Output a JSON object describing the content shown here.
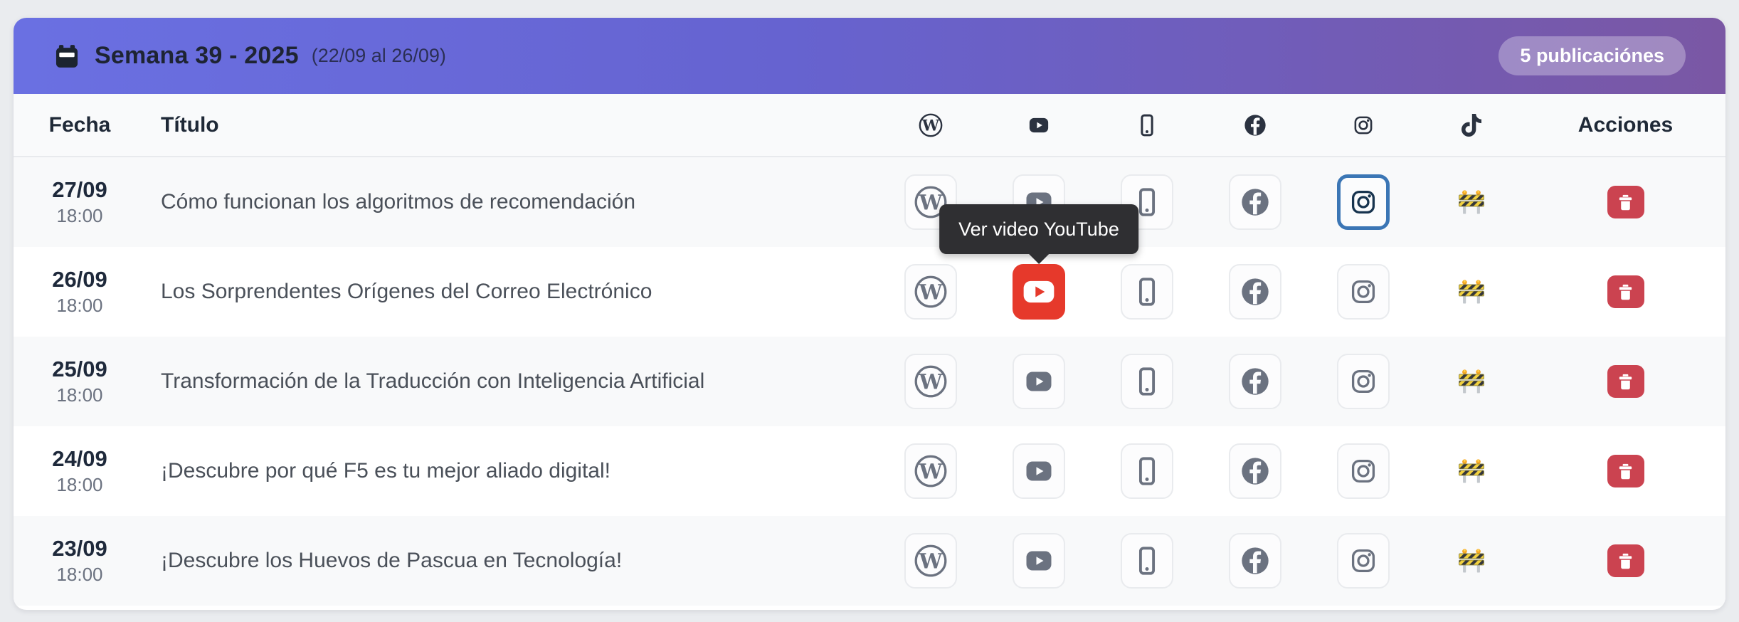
{
  "header": {
    "title": "Semana 39 - 2025",
    "range": "(22/09 al 26/09)",
    "badge": "5 publicaciónes"
  },
  "columns": {
    "fecha": "Fecha",
    "titulo": "Título",
    "acciones": "Acciones",
    "platforms": [
      "wordpress",
      "youtube",
      "mobile-app",
      "facebook",
      "instagram",
      "tiktok"
    ]
  },
  "tooltip": {
    "text": "Ver video YouTube"
  },
  "rows": [
    {
      "date": "27/09",
      "time": "18:00",
      "title": "Cómo funcionan los algoritmos de recomendación",
      "active_platform": "instagram"
    },
    {
      "date": "26/09",
      "time": "18:00",
      "title": "Los Sorprendentes Orígenes del Correo Electrónico",
      "active_platform": "youtube"
    },
    {
      "date": "25/09",
      "time": "18:00",
      "title": "Transformación de la Traducción con Inteligencia Artificial",
      "active_platform": null
    },
    {
      "date": "24/09",
      "time": "18:00",
      "title": "¡Descubre por qué F5 es tu mejor aliado digital!",
      "active_platform": null
    },
    {
      "date": "23/09",
      "time": "18:00",
      "title": "¡Descubre los Huevos de Pascua en Tecnología!",
      "active_platform": null
    }
  ],
  "colors": {
    "header_gradient_start": "#6a70e2",
    "header_gradient_end": "#7a57a4",
    "active_youtube_red": "#e6392b",
    "active_instagram_border": "#3b76b5",
    "delete_button_red": "#cb4350",
    "tooltip_background": "#2f2f32",
    "row_alt_background": "#f8f9fa"
  }
}
